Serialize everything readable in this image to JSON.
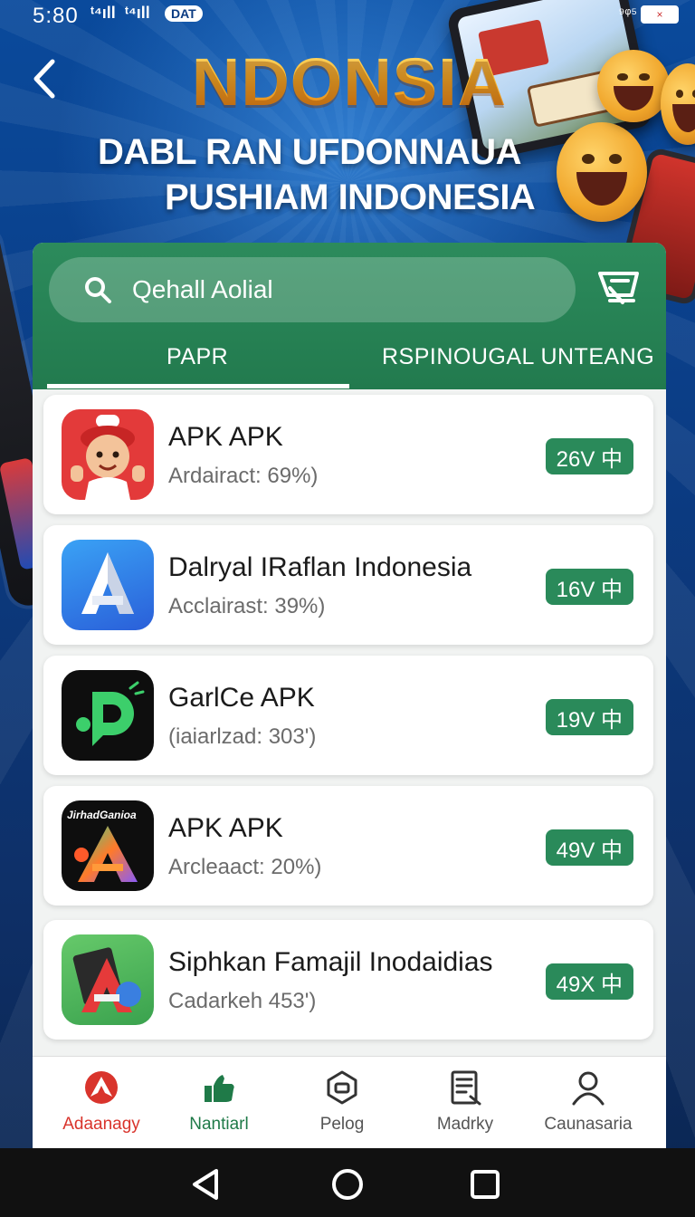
{
  "status_bar": {
    "time": "5:80",
    "signal_1": "ᵗ⁴ıll",
    "signal_2": "ᵗ⁴ıll",
    "badge": "DAT",
    "right_text": "⁹ᵠ⁵",
    "battery": "×"
  },
  "header": {
    "back_icon": "chevron-left-icon",
    "title": "NDONSIA",
    "subtitle_1": "DABL RAN UFDONNAUA",
    "subtitle_2": "PUSHIAM INDONESIA"
  },
  "search": {
    "placeholder": "Qehall Aolial",
    "icon": "search-icon"
  },
  "cart": {
    "icon": "cart-icon"
  },
  "tabs": [
    {
      "label": "PAPR",
      "active": true
    },
    {
      "label": "RSPINOUGAL UNTEANG",
      "active": false
    }
  ],
  "apps": [
    {
      "name": "APK APK",
      "meta": "Ardairact: 69%)",
      "price": "26V 中",
      "icon": "red-mascot-app-icon"
    },
    {
      "name": "Dalryal IRaflan Indonesia",
      "meta": "Acclairast: 39%)",
      "price": "16V 中",
      "icon": "blue-letter-a-app-icon"
    },
    {
      "name": "GarlCe APK",
      "meta": "(iaiarlzad: 303')",
      "price": "19V 中",
      "icon": "green-letter-d-app-icon"
    },
    {
      "name": "APK APK",
      "meta": "Arcleaact: 20%)",
      "price": "49V 中",
      "icon": "gradient-letter-a-app-icon",
      "icon_text": "JirhadGanioa"
    },
    {
      "name": "Siphkan Famajil Inodaidias",
      "meta": "Cadarkeh 453')",
      "price": "49X 中",
      "icon": "green-letter-a-app-icon"
    }
  ],
  "bottom_nav": [
    {
      "label": "Adaanagy",
      "icon": "app-logo-icon",
      "active": true
    },
    {
      "label": "Nantiarl",
      "icon": "hand-icon",
      "active": false
    },
    {
      "label": "Pelog",
      "icon": "box-icon",
      "active": false
    },
    {
      "label": "Madrky",
      "icon": "document-icon",
      "active": false
    },
    {
      "label": "Caunasaria",
      "icon": "profile-icon",
      "active": false
    }
  ],
  "colors": {
    "accent_green": "#2a8a5a",
    "header_green": "#2c8b5c",
    "accent_red": "#d9342c",
    "background_blue": "#0b3b82",
    "title_gold": "#f7b830"
  }
}
